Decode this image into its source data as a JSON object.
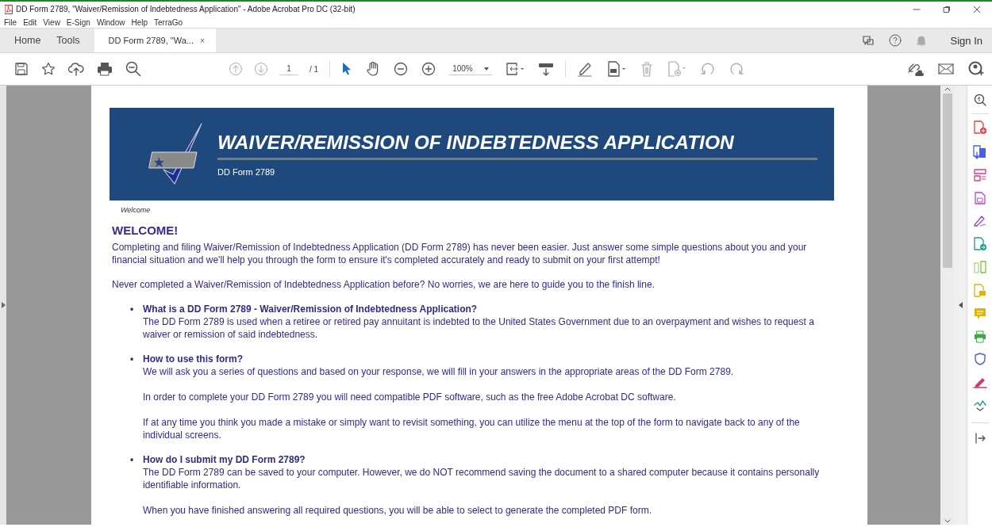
{
  "window": {
    "title": "DD Form 2789, \"Waiver/Remission of Indebtedness Application\" - Adobe Acrobat Pro DC (32-bit)"
  },
  "menu": [
    "File",
    "Edit",
    "View",
    "E-Sign",
    "Window",
    "Help",
    "TerraGo"
  ],
  "tabs": [
    {
      "label": "Home",
      "selected": false
    },
    {
      "label": "Tools",
      "selected": false
    },
    {
      "label": "DD Form 2789, \"Wa...",
      "selected": true,
      "close": "×"
    }
  ],
  "account": {
    "label": "Sign In"
  },
  "toolbar": {
    "page": "1",
    "page_count": "/ 1",
    "zoom": "100%"
  },
  "document": {
    "banner": {
      "title": "WAIVER/REMISSION OF INDEBTEDNESS APPLICATION",
      "subtitle": "DD Form 2789"
    },
    "breadcrumb": "Welcome",
    "heading": "WELCOME!",
    "intro": [
      "Completing and filing Waiver/Remission of Indebtedness Application (DD Form 2789) has never been easier. Just answer some simple questions about you and your financial situation and we'll help you through the form to ensure it's completed accurately and ready to submit on your first attempt!",
      "Never completed a Waiver/Remission of Indebtedness Application before? No worries, we are here to guide you to the finish line."
    ],
    "faq": [
      {
        "bullet": "•",
        "question": "What is a DD Form 2789 - Waiver/Remission of Indebtedness Application?",
        "answers": [
          "The DD Form 2789 is used when a retiree or retired pay annuitant is indebted to the United States Government due to an overpayment and wishes to request a waiver or remission of said indebtedness."
        ]
      },
      {
        "bullet": "•",
        "question": "How to use this form?",
        "answers": [
          "We will ask you a series of questions and based on your response, we will fill in your answers in the appropriate areas of the DD Form 2789.",
          "In order to complete your DD Form 2789 you will need compatible PDF software, such as the free Adobe Acrobat DC software.",
          "If at any time you think you made a mistake or simply want to revisit something, you can utilize the menu at the top of the form to navigate back to any of the individual screens."
        ]
      },
      {
        "bullet": "•",
        "question": "How do I submit my DD Form 2789?",
        "answers": [
          "The DD Form 2789 can be saved to your computer. However, we do NOT recommend saving the document to a shared computer because it contains personally identifiable information.",
          "When you have finished answering all required questions, you will be able to select to generate the completed PDF form."
        ]
      }
    ]
  }
}
